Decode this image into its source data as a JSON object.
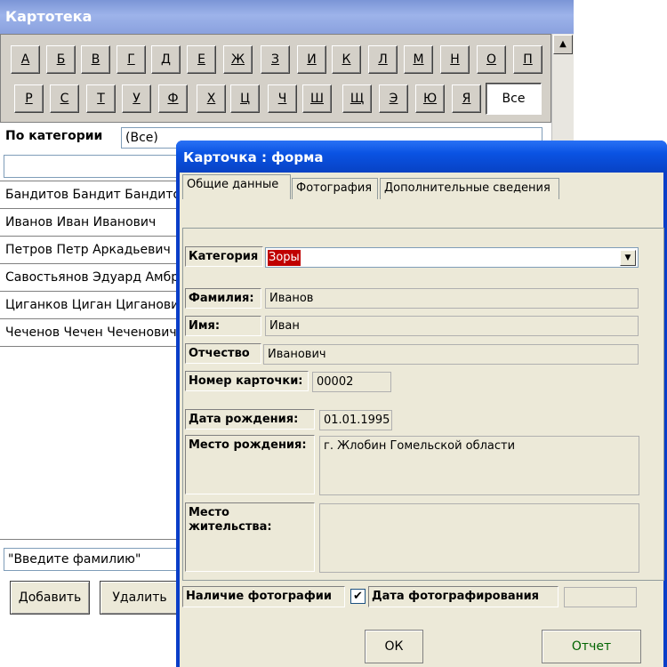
{
  "back_window": {
    "title": "Картотека",
    "letters_row1": [
      "А",
      "Б",
      "В",
      "Г",
      "Д",
      "Е",
      "Ж",
      "З",
      "И",
      "К",
      "Л",
      "М",
      "Н",
      "О",
      "П"
    ],
    "letters_row2": [
      "Р",
      "С",
      "Т",
      "У",
      "Ф",
      "Х",
      "Ц",
      "Ч",
      "Ш",
      "Щ",
      "Э",
      "Ю",
      "Я"
    ],
    "all_label": "Все",
    "category_label": "По категории",
    "category_value": "(Все)",
    "list_items": [
      "Бандитов Бандит Бандитович",
      "Иванов Иван Иванович",
      "Петров Петр Аркадьевич",
      "Савостьянов Эдуард Амбросиевич",
      "Циганков Циган Циганович",
      "Чеченов Чечен Чеченович"
    ],
    "surname_input_value": "\"Введите фамилию\"",
    "add_button": "Добавить",
    "delete_button": "Удалить"
  },
  "card_dialog": {
    "title": "Карточка : форма",
    "tabs": [
      "Общие данные",
      "Фотография",
      "Дополнительные сведения"
    ],
    "fields": {
      "category_label": "Категория",
      "category_value": "Зоры",
      "surname_label": "Фамилия:",
      "surname_value": "Иванов",
      "name_label": "Имя:",
      "name_value": "Иван",
      "patronymic_label": "Отчество",
      "patronymic_value": "Иванович",
      "card_number_label": "Номер карточки:",
      "card_number_value": "00002",
      "birth_date_label": "Дата рождения:",
      "birth_date_value": "01.01.1995",
      "birth_place_label": "Место рождения:",
      "birth_place_value": "г. Жлобин Гомельской области",
      "residence_label": "Место жительства:",
      "residence_value": "",
      "photo_presence_label": "Наличие фотографии",
      "photo_checked": "✔",
      "photo_date_label": "Дата фотографирования",
      "photo_date_value": ""
    },
    "ok_button": "ОК",
    "report_button": "Отчет"
  },
  "colors": {
    "xp_blue": "#0a53e3",
    "classic_title": "#8aa1de",
    "face": "#ece9d8",
    "report_text": "#006400",
    "highlight": "#c00000"
  }
}
